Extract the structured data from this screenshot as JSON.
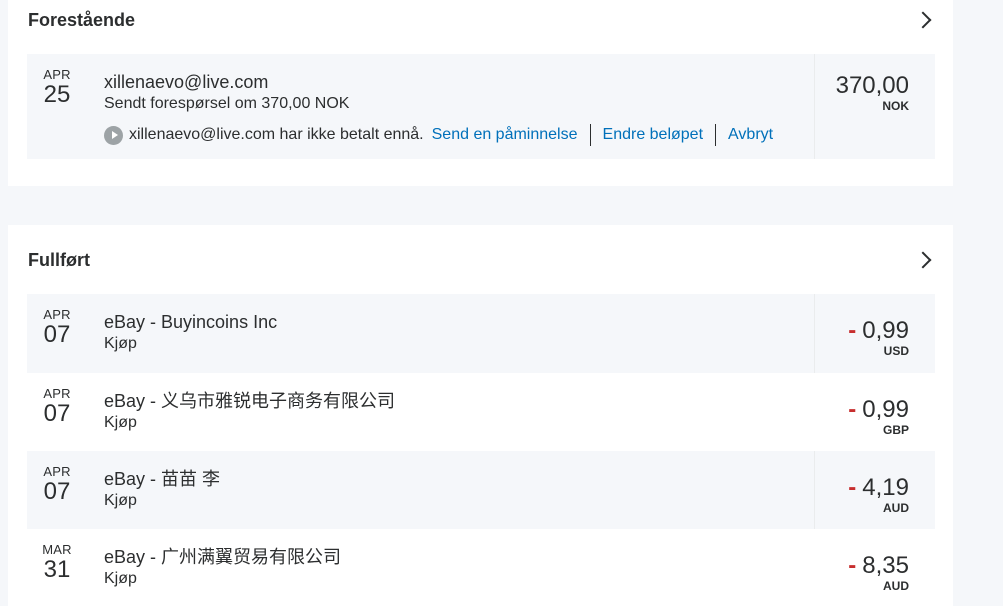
{
  "pending": {
    "title": "Forestående",
    "item": {
      "month": "APR",
      "day": "25",
      "name": "xillenaevo@live.com",
      "description": "Sendt forespørsel om 370,00 NOK",
      "amount": "370,00",
      "currency": "NOK",
      "status_text": "xillenaevo@live.com har ikke betalt ennå.",
      "actions": [
        "Send en påminnelse",
        "Endre beløpet",
        "Avbryt"
      ]
    }
  },
  "completed": {
    "title": "Fullført",
    "items": [
      {
        "month": "APR",
        "day": "07",
        "name": "eBay - Buyincoins Inc",
        "type": "Kjøp",
        "sign": "-",
        "amount": "0,99",
        "currency": "USD"
      },
      {
        "month": "APR",
        "day": "07",
        "name": "eBay - 义乌市雅锐电子商务有限公司",
        "type": "Kjøp",
        "sign": "-",
        "amount": "0,99",
        "currency": "GBP"
      },
      {
        "month": "APR",
        "day": "07",
        "name": "eBay - 苗苗 李",
        "type": "Kjøp",
        "sign": "-",
        "amount": "4,19",
        "currency": "AUD"
      },
      {
        "month": "MAR",
        "day": "31",
        "name": "eBay - 广州满翼贸易有限公司",
        "type": "Kjøp",
        "sign": "-",
        "amount": "8,35",
        "currency": "AUD"
      }
    ]
  },
  "colors": {
    "link": "#0070ba",
    "negative": "#c72e2e",
    "text": "#2c2e2f",
    "row_shade": "#f5f7fa"
  }
}
